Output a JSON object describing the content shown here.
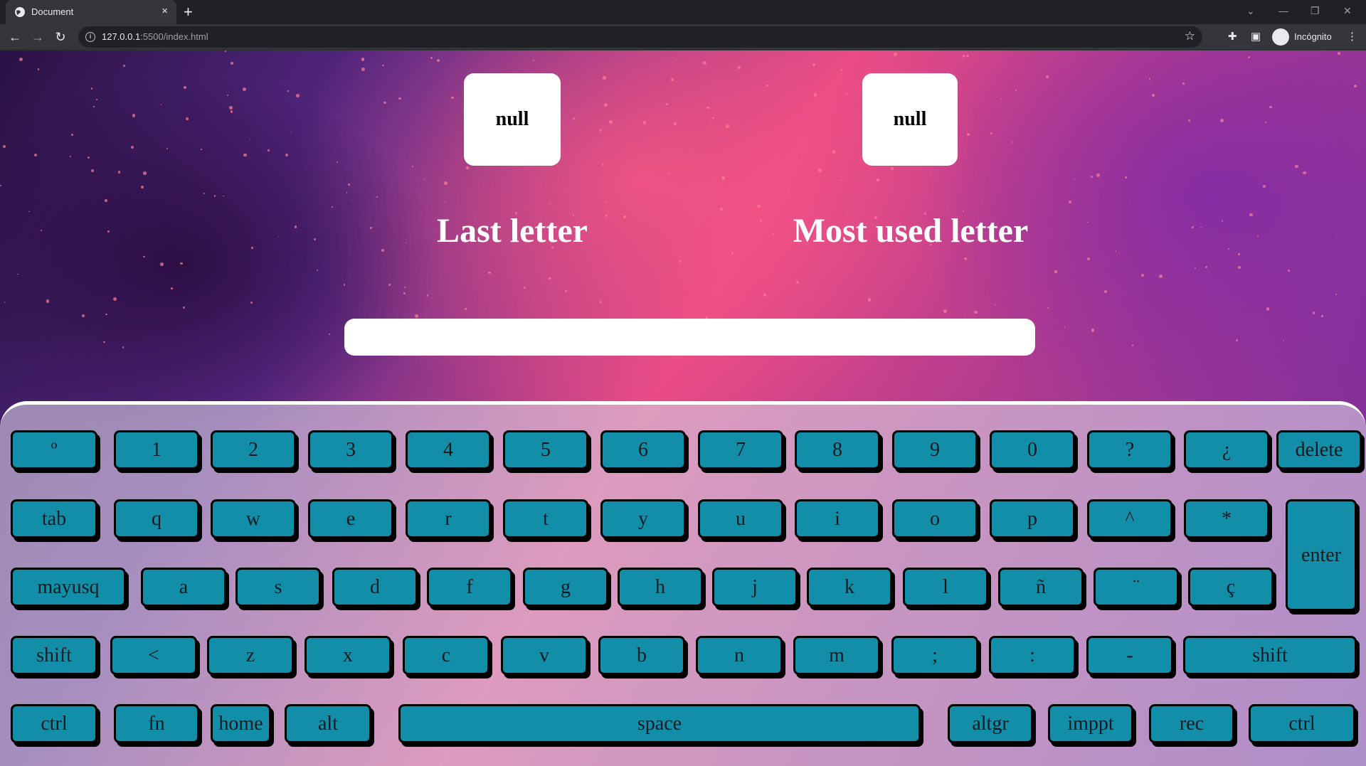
{
  "browser": {
    "tab_title": "Document",
    "tab_close": "×",
    "new_tab": "+",
    "url_host": "127.0.0.1",
    "url_path": ":5500/index.html",
    "profile_label": "Incógnito",
    "window_controls": [
      "⌄",
      "—",
      "❐",
      "✕"
    ]
  },
  "stats": {
    "last_letter_value": "null",
    "last_letter_label": "Last letter",
    "most_used_value": "null",
    "most_used_label": "Most used letter"
  },
  "input": {
    "value": "",
    "placeholder": ""
  },
  "keyboard": {
    "key_color": "#138ea9",
    "rows": [
      [
        "º",
        "1",
        "2",
        "3",
        "4",
        "5",
        "6",
        "7",
        "8",
        "9",
        "0",
        "?",
        "¿",
        "delete"
      ],
      [
        "tab",
        "q",
        "w",
        "e",
        "r",
        "t",
        "y",
        "u",
        "i",
        "o",
        "p",
        "^",
        "*",
        "enter"
      ],
      [
        "mayusq",
        "a",
        "s",
        "d",
        "f",
        "g",
        "h",
        "j",
        "k",
        "l",
        "ñ",
        "¨",
        "ç"
      ],
      [
        "shift",
        "<",
        "z",
        "x",
        "c",
        "v",
        "b",
        "n",
        "m",
        ";",
        ":",
        "-",
        "shift"
      ],
      [
        "ctrl",
        "fn",
        "home",
        "alt",
        "space",
        "altgr",
        "imppt",
        "rec",
        "ctrl"
      ]
    ]
  }
}
